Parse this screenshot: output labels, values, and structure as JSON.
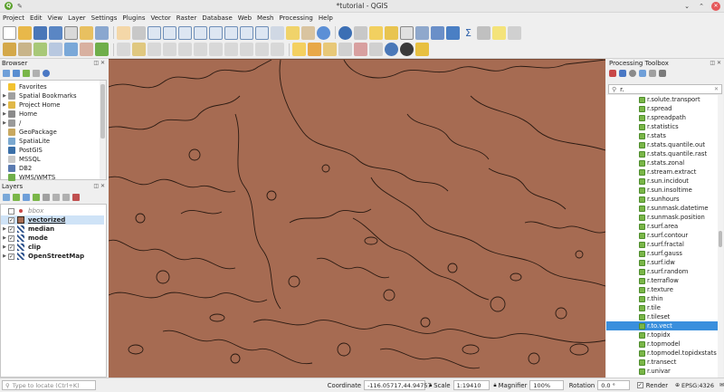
{
  "window": {
    "title": "*tutorial - QGIS"
  },
  "menu": [
    "Project",
    "Edit",
    "View",
    "Layer",
    "Settings",
    "Plugins",
    "Vector",
    "Raster",
    "Database",
    "Web",
    "Mesh",
    "Processing",
    "Help"
  ],
  "browser": {
    "title": "Browser",
    "items": [
      "Favorites",
      "Spatial Bookmarks",
      "Project Home",
      "Home",
      "/",
      "GeoPackage",
      "SpatiaLite",
      "PostGIS",
      "MSSQL",
      "DB2",
      "WMS/WMTS"
    ]
  },
  "layers": {
    "title": "Layers",
    "items": [
      "bbox",
      "vectorized",
      "median",
      "mode",
      "clip",
      "OpenStreetMap"
    ]
  },
  "processing": {
    "title": "Processing Toolbox",
    "search": "r.",
    "algorithms": [
      "r.solute.transport",
      "r.spread",
      "r.spreadpath",
      "r.statistics",
      "r.stats",
      "r.stats.quantile.out",
      "r.stats.quantile.rast",
      "r.stats.zonal",
      "r.stream.extract",
      "r.sun.incidout",
      "r.sun.insoltime",
      "r.sunhours",
      "r.sunmask.datetime",
      "r.sunmask.position",
      "r.surf.area",
      "r.surf.contour",
      "r.surf.fractal",
      "r.surf.gauss",
      "r.surf.idw",
      "r.surf.random",
      "r.terraflow",
      "r.texture",
      "r.thin",
      "r.tile",
      "r.tileset",
      "r.to.vect",
      "r.topidx",
      "r.topmodel",
      "r.topmodel.topidxstats",
      "r.transect",
      "r.univar"
    ],
    "selected": "r.to.vect"
  },
  "status": {
    "locate_placeholder": "Type to locate (Ctrl+K)",
    "coordinate_label": "Coordinate",
    "coordinate": "-116.05717,44.94757",
    "scale_label": "Scale",
    "scale": "1:19410",
    "magnifier_label": "Magnifier",
    "magnifier": "100%",
    "rotation_label": "Rotation",
    "rotation": "0.0 °",
    "render_label": "Render",
    "crs": "EPSG:4326"
  },
  "colors": {
    "map_fill": "#a66b52",
    "selection": "#3a8fdd"
  }
}
